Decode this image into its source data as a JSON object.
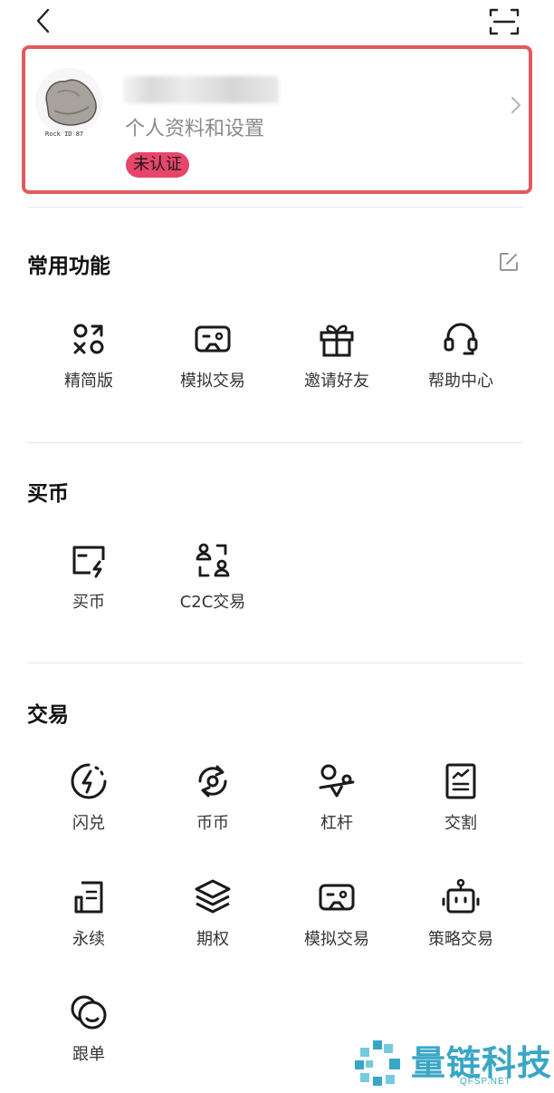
{
  "header": {
    "back_icon": "back-arrow-icon",
    "scan_icon": "scan-icon"
  },
  "profile": {
    "avatar_caption": "Rock ID 87",
    "subtitle": "个人资料和设置",
    "verification_badge": "未认证",
    "highlight_color": "#e25a5e",
    "badge_color": "#e8456b"
  },
  "sections": {
    "common": {
      "title": "常用功能",
      "items": [
        {
          "label": "精简版",
          "icon": "lite-mode-icon"
        },
        {
          "label": "模拟交易",
          "icon": "gamepad-icon"
        },
        {
          "label": "邀请好友",
          "icon": "gift-icon"
        },
        {
          "label": "帮助中心",
          "icon": "headset-icon"
        }
      ]
    },
    "buy": {
      "title": "买币",
      "items": [
        {
          "label": "买币",
          "icon": "card-flash-icon"
        },
        {
          "label": "C2C交易",
          "icon": "c2c-users-icon"
        }
      ]
    },
    "trade": {
      "title": "交易",
      "items": [
        {
          "label": "闪兑",
          "icon": "flash-swap-icon"
        },
        {
          "label": "币币",
          "icon": "coin-swap-icon"
        },
        {
          "label": "杠杆",
          "icon": "leverage-icon"
        },
        {
          "label": "交割",
          "icon": "delivery-icon"
        },
        {
          "label": "永续",
          "icon": "perpetual-icon"
        },
        {
          "label": "期权",
          "icon": "layers-icon"
        },
        {
          "label": "模拟交易",
          "icon": "gamepad-icon"
        },
        {
          "label": "策略交易",
          "icon": "robot-icon"
        },
        {
          "label": "跟单",
          "icon": "copy-trade-icon"
        }
      ]
    }
  },
  "watermark": {
    "text": "量链科技",
    "sub": "QFSP.NET"
  }
}
